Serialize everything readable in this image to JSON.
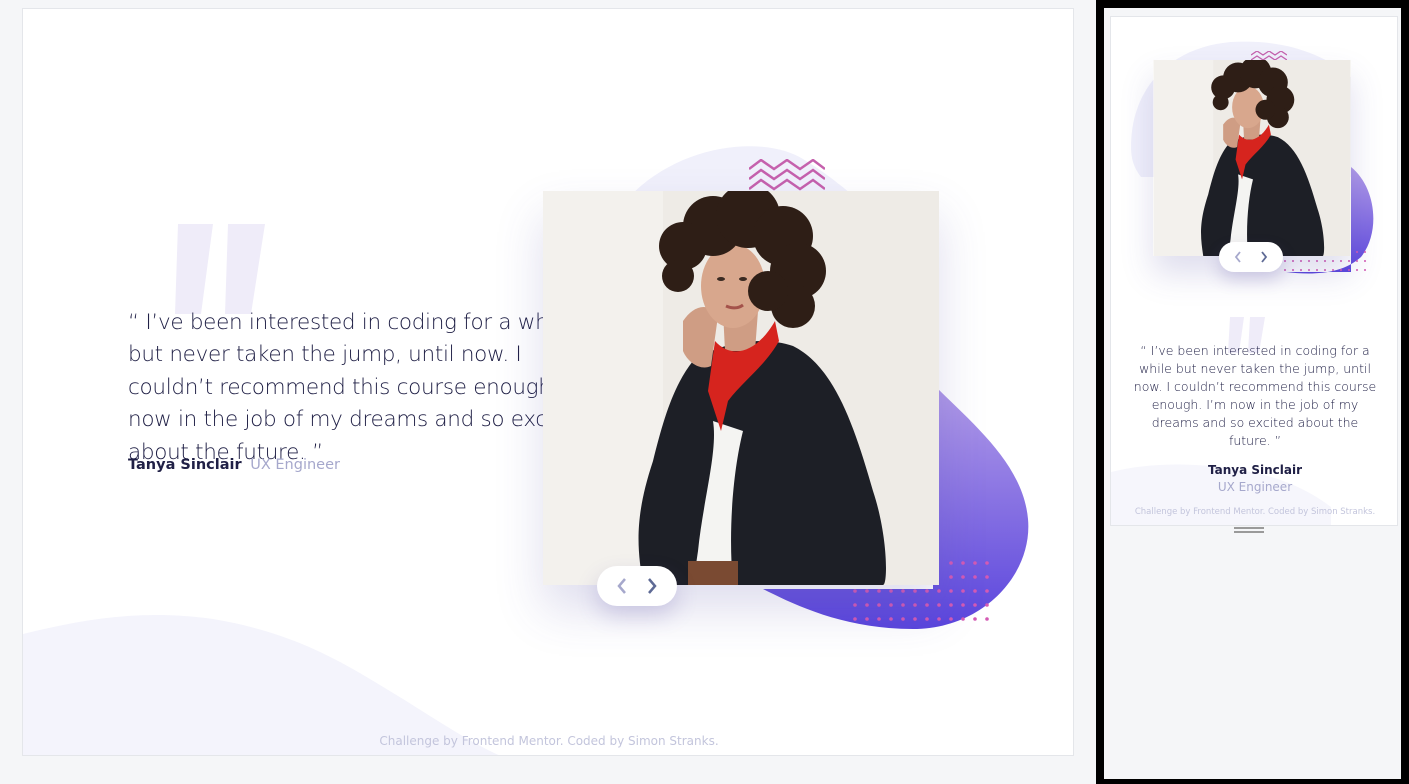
{
  "testimonial": {
    "quote": "“ I’ve been interested in coding for a while but never taken the jump, until now. I couldn’t recommend this course enough. I’m now in the job of my dreams and so excited about the future. ”",
    "author_name": "Tanya Sinclair",
    "author_role": "UX Engineer"
  },
  "footer": {
    "credit": "Challenge by Frontend Mentor. Coded by Simon Stranks."
  },
  "icons": {
    "prev": "chevron-left-icon",
    "next": "chevron-right-icon",
    "quote": "quote-mark-icon",
    "pattern": "zigzag-pattern-icon"
  },
  "colors": {
    "text_dark": "#202046",
    "text_muted": "#a6a8cc",
    "accent_purple": "#6b5be6",
    "accent_pink": "#d45ab4",
    "background_tint": "#f0f0fb"
  }
}
